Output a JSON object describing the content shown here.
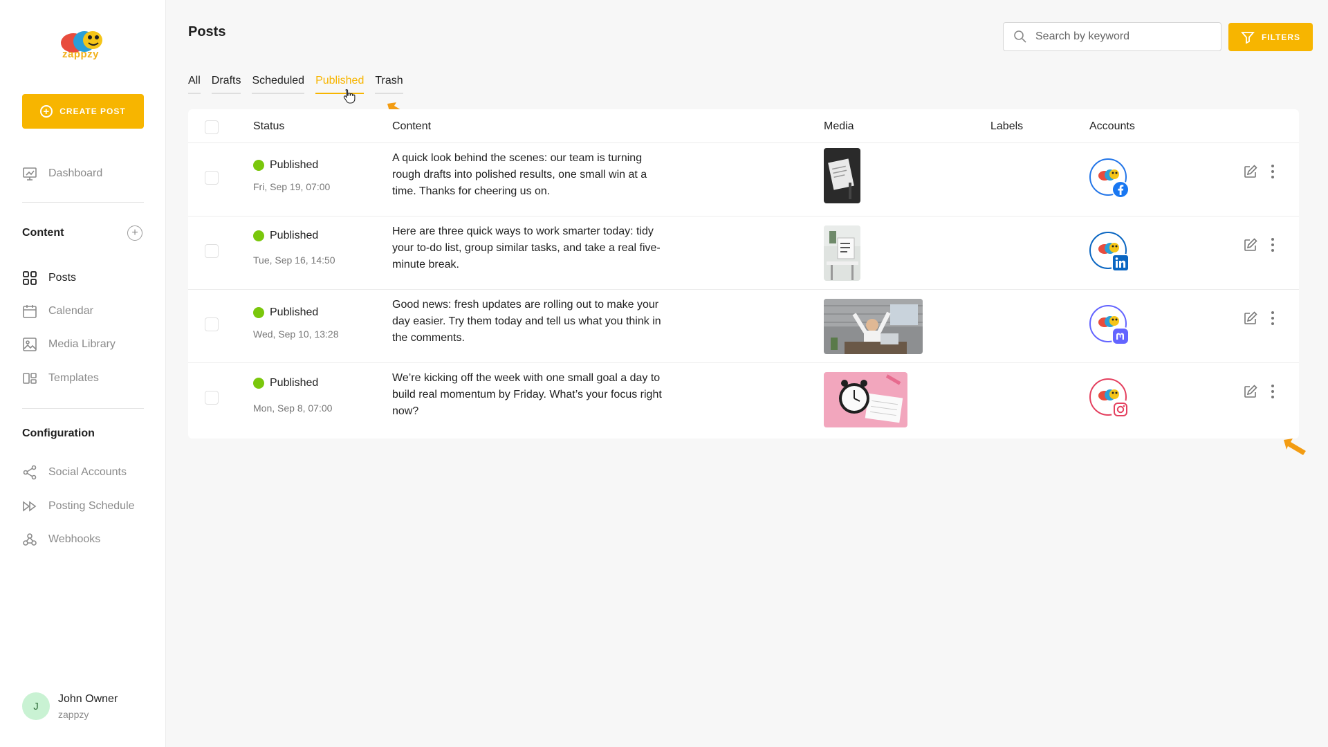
{
  "app": {
    "logo_text": "zappzy"
  },
  "sidebar": {
    "create_button": "CREATE POST",
    "dashboard": "Dashboard",
    "content_title": "Content",
    "content_items": [
      {
        "label": "Posts",
        "icon": "grid-icon",
        "active": true
      },
      {
        "label": "Calendar",
        "icon": "calendar-icon",
        "active": false
      },
      {
        "label": "Media Library",
        "icon": "image-icon",
        "active": false
      },
      {
        "label": "Templates",
        "icon": "template-icon",
        "active": false
      }
    ],
    "config_title": "Configuration",
    "config_items": [
      {
        "label": "Social Accounts",
        "icon": "share-icon"
      },
      {
        "label": "Posting Schedule",
        "icon": "schedule-icon"
      },
      {
        "label": "Webhooks",
        "icon": "webhook-icon"
      }
    ],
    "user": {
      "initial": "J",
      "name": "John Owner",
      "org": "zappzy"
    }
  },
  "header": {
    "title": "Posts",
    "search_placeholder": "Search by keyword",
    "filters_label": "FILTERS"
  },
  "tabs": [
    {
      "label": "All",
      "active": false
    },
    {
      "label": "Drafts",
      "active": false
    },
    {
      "label": "Scheduled",
      "active": false
    },
    {
      "label": "Published",
      "active": true
    },
    {
      "label": "Trash",
      "active": false
    }
  ],
  "table": {
    "columns": [
      "Status",
      "Content",
      "Media",
      "Labels",
      "Accounts"
    ],
    "rows": [
      {
        "status": "Published",
        "date": "Fri, Sep 19, 07:00",
        "content": "A quick look behind the scenes: our team is turning rough drafts into polished results, one small win at a time. Thanks for cheering us on.",
        "media": "notebook-photo",
        "account": "facebook"
      },
      {
        "status": "Published",
        "date": "Tue, Sep 16, 14:50",
        "content": "Here are three quick ways to work smarter today: tidy your to-do list, group similar tasks, and take a real five-minute break.",
        "media": "desk-photo",
        "account": "linkedin"
      },
      {
        "status": "Published",
        "date": "Wed, Sep 10, 13:28",
        "content": "Good news: fresh updates are rolling out to make your day easier. Try them today and tell us what you think in the comments.",
        "media": "celebrating-person-photo",
        "account": "mastodon"
      },
      {
        "status": "Published",
        "date": "Mon, Sep 8, 07:00",
        "content": "We’re kicking off the week with one small goal a day to build real momentum by Friday. What’s your focus right now?",
        "media": "alarm-clock-photo",
        "account": "instagram"
      }
    ]
  },
  "colors": {
    "accent": "#f7b500",
    "published_dot": "#7ac70c",
    "annotation_arrow": "#f39c12"
  }
}
